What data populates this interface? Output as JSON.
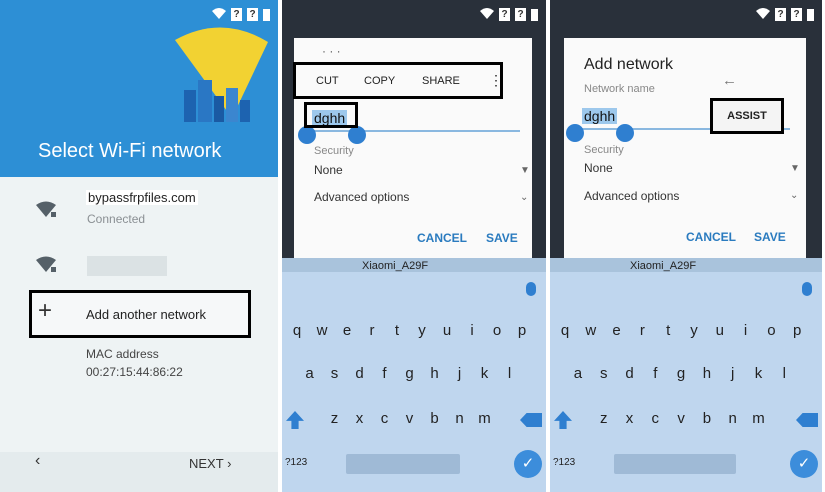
{
  "panel1": {
    "title": "Select Wi-Fi network",
    "network1_name": "bypassfrpfiles.com",
    "network1_status": "Connected",
    "add_network_label": "Add another network",
    "mac_label": "MAC address",
    "mac_value": "00:27:15:44:86:22",
    "next_label": "NEXT",
    "back_glyph": "‹",
    "next_glyph": "›"
  },
  "status": {
    "q1": "?",
    "q2": "?"
  },
  "panel2": {
    "dots": "· · ·",
    "cut": "CUT",
    "copy": "COPY",
    "share": "SHARE",
    "more": "⋮",
    "field_value": "dghh",
    "security_label": "Security",
    "security_value": "None",
    "advanced_label": "Advanced options",
    "cancel": "CANCEL",
    "save": "SAVE",
    "strip_text": "Xiaomi_A29F"
  },
  "panel3": {
    "title": "Add network",
    "name_label": "Network name",
    "back_arrow": "←",
    "field_value": "dghh",
    "assist": "ASSIST",
    "security_label": "Security",
    "security_value": "None",
    "advanced_label": "Advanced options",
    "cancel": "CANCEL",
    "save": "SAVE",
    "strip_text": "Xiaomi_A29F"
  },
  "keyboard": {
    "row1": [
      "q",
      "w",
      "e",
      "r",
      "t",
      "y",
      "u",
      "i",
      "o",
      "p"
    ],
    "row2": [
      "a",
      "s",
      "d",
      "f",
      "g",
      "h",
      "j",
      "k",
      "l"
    ],
    "row3": [
      "z",
      "x",
      "c",
      "v",
      "b",
      "n",
      "m"
    ],
    "sym": "?123",
    "enter": "✓"
  },
  "colors": {
    "accent": "#2f7fd0",
    "hero": "#2d8fd5",
    "keyboard": "#bfd6ee"
  }
}
